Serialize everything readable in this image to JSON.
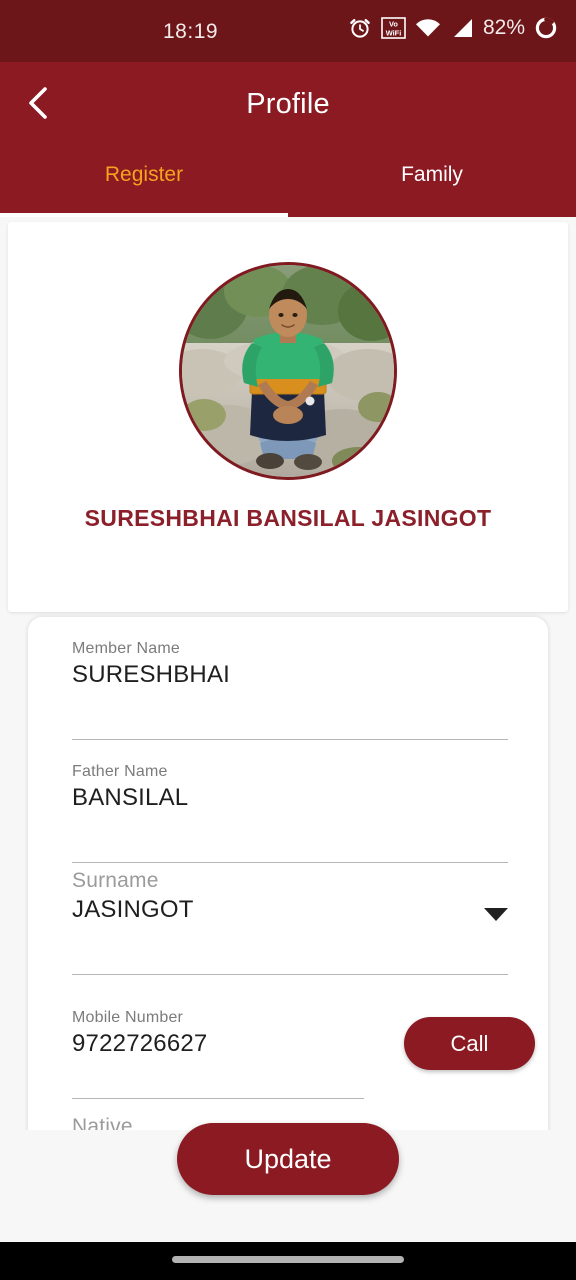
{
  "status_bar": {
    "clock": "18:19",
    "battery_percent": "82%",
    "icons": [
      "alarm-clock-icon",
      "vowifi-icon",
      "wifi-icon",
      "cellular-signal-icon",
      "battery-ring-icon"
    ],
    "background_color": "#6d1619"
  },
  "app_bar": {
    "back_icon": "chevron-left-icon",
    "title": "Profile",
    "background_color": "#8b1a22"
  },
  "tabs": {
    "items": [
      {
        "label": "Register",
        "active": true
      },
      {
        "label": "Family",
        "active": false
      }
    ],
    "active_color": "#f5a21f",
    "inactive_color": "#ffffff",
    "indicator_color": "#ffffff"
  },
  "profile": {
    "avatar_icon": "user-photo",
    "avatar_alt": "man sitting on rocks outdoors wearing green and navy sweatshirt",
    "name": "SURESHBHAI BANSILAL JASINGOT",
    "name_color": "#8b1f2a"
  },
  "form": {
    "fields": [
      {
        "label": "Member Name",
        "value": "SURESHBHAI",
        "type": "text"
      },
      {
        "label": "Father Name",
        "value": "BANSILAL",
        "type": "text"
      },
      {
        "label": "Surname",
        "value": "JASINGOT",
        "type": "dropdown"
      },
      {
        "label": "Mobile Number",
        "value": "9722726627",
        "type": "tel"
      },
      {
        "label": "Native",
        "value": "",
        "type": "dropdown"
      }
    ]
  },
  "actions": {
    "call_label": "Call",
    "update_label": "Update",
    "button_color": "#8b1a22"
  },
  "nav_bar": {
    "gesture_pill": "home-gesture-pill",
    "background_color": "#000000"
  }
}
